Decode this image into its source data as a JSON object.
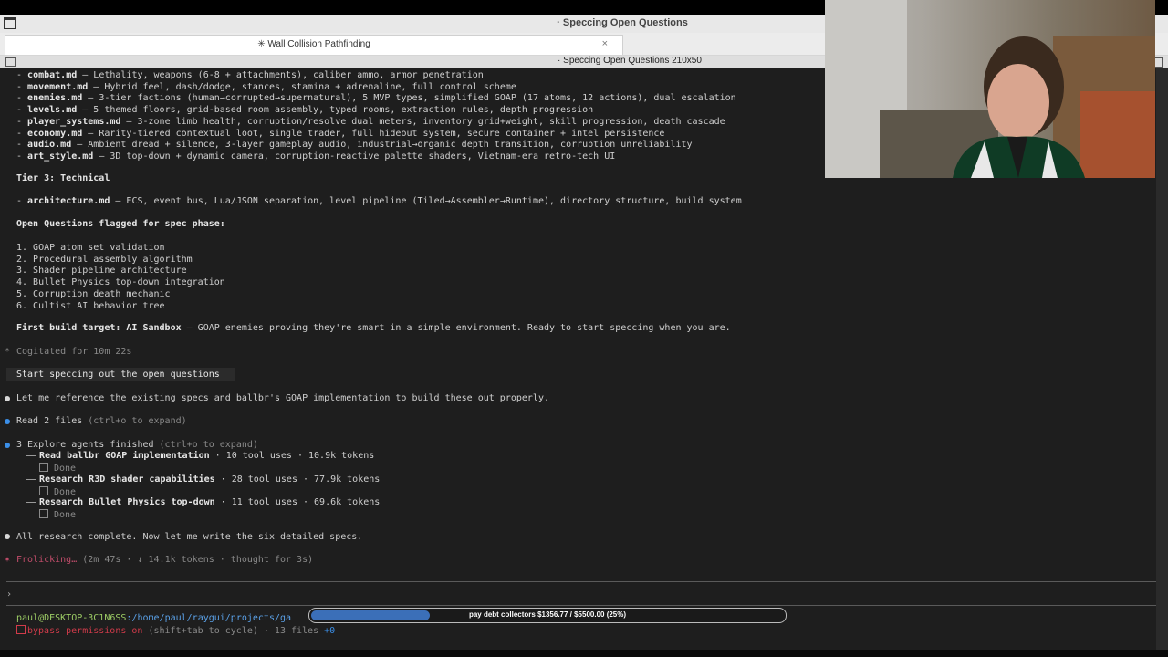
{
  "window": {
    "title": "· Speccing Open Questions"
  },
  "tabs": [
    {
      "label": "✳ Wall Collision Pathfinding",
      "close": "×"
    }
  ],
  "pane": {
    "title": "· Speccing Open Questions 210x50"
  },
  "terminal": {
    "spec_lines": [
      {
        "name": "combat.md",
        "desc": " — Lethality, weapons (6-8 + attachments), caliber ammo, armor penetration"
      },
      {
        "name": "movement.md",
        "desc": " — Hybrid feel, dash/dodge, stances, stamina + adrenaline, full control scheme"
      },
      {
        "name": "enemies.md",
        "desc": " — 3-tier factions (human→corrupted→supernatural), 5 MVP types, simplified GOAP (17 atoms, 12 actions), dual escalation"
      },
      {
        "name": "levels.md",
        "desc": " — 5 themed floors, grid-based room assembly, typed rooms, extraction rules, depth progression"
      },
      {
        "name": "player_systems.md",
        "desc": " — 3-zone limb health, corruption/resolve dual meters, inventory grid+weight, skill progression, death cascade"
      },
      {
        "name": "economy.md",
        "desc": " — Rarity-tiered contextual loot, single trader, full hideout system, secure container + intel persistence"
      },
      {
        "name": "audio.md",
        "desc": " — Ambient dread + silence, 3-layer gameplay audio, industrial→organic depth transition, corruption unreliability"
      },
      {
        "name": "art_style.md",
        "desc": " — 3D top-down + dynamic camera, corruption-reactive palette shaders, Vietnam-era retro-tech UI"
      }
    ],
    "tier3_heading": "Tier 3: Technical",
    "arch_name": "architecture.md",
    "arch_desc": " — ECS, event bus, Lua/JSON separation, level pipeline (Tiled→Assembler→Runtime), directory structure, build system",
    "open_heading": "Open Questions flagged for spec phase:",
    "open_items": [
      "1. GOAP atom set validation",
      "2. Procedural assembly algorithm",
      "3. Shader pipeline architecture",
      "4. Bullet Physics top-down integration",
      "5. Corruption death mechanic",
      "6. Cultist AI behavior tree"
    ],
    "first_build_bold": "First build target: AI Sandbox",
    "first_build_rest": " — GOAP enemies proving they're smart in a simple environment. Ready to start speccing when you are.",
    "cogitated": "Cogitated for 10m 22s",
    "user_prompt": "Start speccing out the open questions",
    "reply1": "Let me reference the existing specs and ballbr's GOAP implementation to build these out properly.",
    "read_files": "Read 2 files",
    "read_hint": " (ctrl+o to expand)",
    "explore_head": "3 Explore agents finished",
    "explore_hint": " (ctrl+o to expand)",
    "agents": [
      {
        "title": "Read ballbr GOAP implementation",
        "stats": " · 10 tool uses · 10.9k tokens",
        "status": "Done"
      },
      {
        "title": "Research R3D shader capabilities",
        "stats": " · 28 tool uses · 77.9k tokens",
        "status": "Done"
      },
      {
        "title": "Research Bullet Physics top-down",
        "stats": " · 11 tool uses · 69.6k tokens",
        "status": "Done"
      }
    ],
    "research_done": "All research complete. Now let me write the six detailed specs.",
    "frolicking": "Frolicking…",
    "frolicking_stats": " (2m 47s · ↓ 14.1k tokens · thought for 3s)",
    "prompt_char": "›",
    "path_user": "paul@DESKTOP-3C1N6SS",
    "path_dir": ":/home/paul/raygui/projects/ga",
    "bypass": "bypass permissions on",
    "bypass_rest": " (shift+tab to cycle) · 13 files ",
    "plus_zero": "+0"
  },
  "progress": {
    "label": "pay debt collectors $1356.77 / $5500.00 (25%)",
    "fraction": 0.25
  },
  "colors": {
    "accent_blue": "#3b8fe8",
    "bullet_white": "#d8d8d8",
    "red": "#d13b4a",
    "green_prompt": "#9ccc65",
    "path_blue": "#5aa0e6",
    "spinner_pink": "#c24d6b"
  }
}
